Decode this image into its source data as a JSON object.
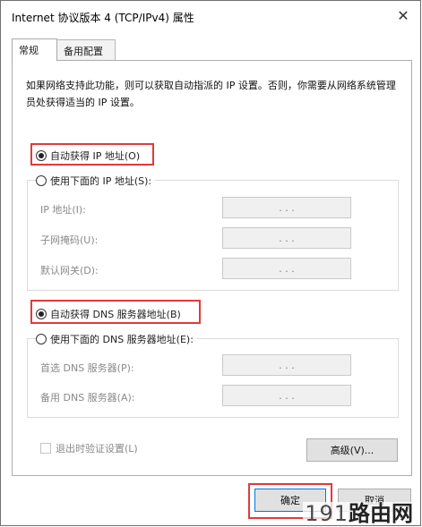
{
  "window": {
    "title": "Internet 协议版本 4 (TCP/IPv4) 属性",
    "close_symbol": "✕"
  },
  "tabs": [
    {
      "label": "常规",
      "active": true
    },
    {
      "label": "备用配置",
      "active": false
    }
  ],
  "description": "如果网络支持此功能，则可以获取自动指派的 IP 设置。否则，你需要从网络系统管理员处获得适当的 IP 设置。",
  "ip_section": {
    "auto_option": {
      "label": "自动获得 IP 地址(O)",
      "selected": true
    },
    "manual_option": {
      "label": "使用下面的 IP 地址(S):",
      "selected": false
    },
    "fields": [
      {
        "label": "IP 地址(I):",
        "value": ".   .   ."
      },
      {
        "label": "子网掩码(U):",
        "value": ".   .   ."
      },
      {
        "label": "默认网关(D):",
        "value": ".   .   ."
      }
    ]
  },
  "dns_section": {
    "auto_option": {
      "label": "自动获得 DNS 服务器地址(B)",
      "selected": true
    },
    "manual_option": {
      "label": "使用下面的 DNS 服务器地址(E):",
      "selected": false
    },
    "fields": [
      {
        "label": "首选 DNS 服务器(P):",
        "value": ".   .   ."
      },
      {
        "label": "备用 DNS 服务器(A):",
        "value": ".   .   ."
      }
    ]
  },
  "validate_checkbox": {
    "label": "退出时验证设置(L)",
    "checked": false
  },
  "buttons": {
    "advanced": "高级(V)...",
    "ok": "确定",
    "cancel": "取消"
  },
  "watermark": {
    "number": "191",
    "text": "路由网"
  },
  "colors": {
    "highlight": "#e23a3a",
    "disabled_text": "#8a8a8a"
  }
}
